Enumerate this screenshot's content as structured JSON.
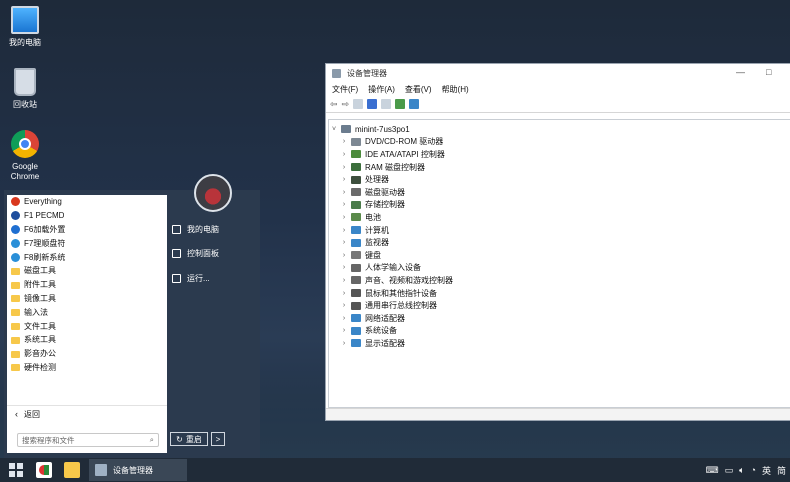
{
  "desktop": {
    "icons": [
      {
        "label": "我的电脑",
        "icon": "computer-icon"
      },
      {
        "label": "回收站",
        "icon": "recycle-bin-icon"
      },
      {
        "label": "Google\nChrome",
        "icon": "chrome-icon"
      }
    ]
  },
  "start_menu": {
    "programs": [
      {
        "label": "Everything",
        "icon": "search-app-icon",
        "color": "#d9381e"
      },
      {
        "label": "F1 PECMD",
        "icon": "help-icon",
        "color": "#1f4e9e"
      },
      {
        "label": "F6加载外置",
        "icon": "info-icon",
        "color": "#1f6fd1"
      },
      {
        "label": "F7理顺盘符",
        "icon": "drive-icon",
        "color": "#2a8fd8"
      },
      {
        "label": "F8刷新系统",
        "icon": "refresh-icon",
        "color": "#2a8fd8"
      },
      {
        "label": "磁盘工具",
        "icon": "folder-icon",
        "color": "#f7c84a"
      },
      {
        "label": "附件工具",
        "icon": "folder-icon",
        "color": "#f7c84a"
      },
      {
        "label": "镜像工具",
        "icon": "folder-icon",
        "color": "#f7c84a"
      },
      {
        "label": "输入法",
        "icon": "folder-icon",
        "color": "#f7c84a"
      },
      {
        "label": "文件工具",
        "icon": "folder-icon",
        "color": "#f7c84a"
      },
      {
        "label": "系统工具",
        "icon": "folder-icon",
        "color": "#f7c84a"
      },
      {
        "label": "影音办公",
        "icon": "folder-icon",
        "color": "#f7c84a"
      },
      {
        "label": "硬件检测",
        "icon": "folder-icon",
        "color": "#f7c84a"
      }
    ],
    "back_label": "返回",
    "search_placeholder": "搜索程序和文件",
    "right_links": [
      {
        "label": "我的电脑",
        "icon": "computer-icon"
      },
      {
        "label": "控制面板",
        "icon": "control-panel-icon"
      },
      {
        "label": "运行...",
        "icon": "run-icon"
      }
    ],
    "restart_label": "重启",
    "more_label": ">"
  },
  "device_manager": {
    "title": "设备管理器",
    "min_label": "—",
    "max_label": "□",
    "menu": [
      "文件(F)",
      "操作(A)",
      "查看(V)",
      "帮助(H)"
    ],
    "root": "minint-7us3po1",
    "categories": [
      {
        "label": "DVD/CD-ROM 驱动器",
        "color": "#7d8893"
      },
      {
        "label": "IDE ATA/ATAPI 控制器",
        "color": "#4b8b3b"
      },
      {
        "label": "RAM 磁盘控制器",
        "color": "#3b6e3b"
      },
      {
        "label": "处理器",
        "color": "#3d4f3d"
      },
      {
        "label": "磁盘驱动器",
        "color": "#6b6b6b"
      },
      {
        "label": "存储控制器",
        "color": "#4a7b4a"
      },
      {
        "label": "电池",
        "color": "#5a8a4a"
      },
      {
        "label": "计算机",
        "color": "#3a86c8"
      },
      {
        "label": "监视器",
        "color": "#3a86c8"
      },
      {
        "label": "键盘",
        "color": "#777777"
      },
      {
        "label": "人体学输入设备",
        "color": "#666666"
      },
      {
        "label": "声音、视频和游戏控制器",
        "color": "#666666"
      },
      {
        "label": "鼠标和其他指针设备",
        "color": "#555555"
      },
      {
        "label": "通用串行总线控制器",
        "color": "#555555"
      },
      {
        "label": "网络适配器",
        "color": "#3a86c8"
      },
      {
        "label": "系统设备",
        "color": "#3a86c8"
      },
      {
        "label": "显示适配器",
        "color": "#3a86c8"
      }
    ]
  },
  "taskbar": {
    "active_task": "设备管理器",
    "tray": {
      "lang": "英",
      "ime": "简"
    }
  }
}
